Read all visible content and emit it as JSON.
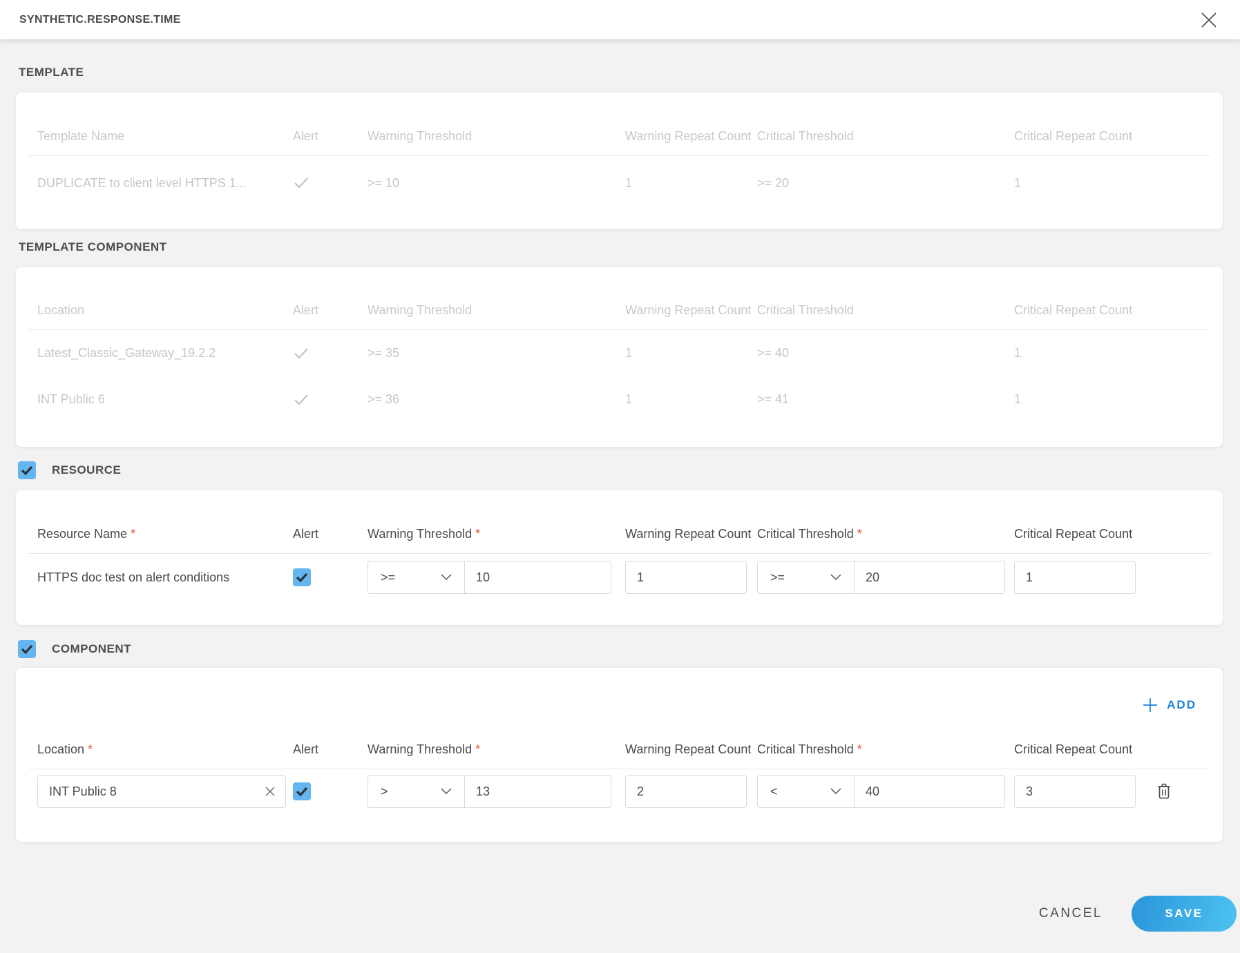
{
  "modal": {
    "title": "SYNTHETIC.RESPONSE.TIME"
  },
  "required_marker": "*",
  "colors": {
    "accent_blue": "#1b82dd",
    "checkbox_blue": "#64b5f0",
    "required_red": "#e4502e",
    "save_gradient_start": "#2b95d9",
    "save_gradient_end": "#4cc2f1",
    "muted_text": "#c9c9c9"
  },
  "icons": {
    "close": "close-icon",
    "check": "check-icon",
    "chevron_down": "chevron-down-icon",
    "plus": "plus-icon",
    "trash": "trash-icon",
    "clear": "clear-icon"
  },
  "sections": {
    "template": {
      "title": "TEMPLATE",
      "headers": {
        "name": "Template Name",
        "alert": "Alert",
        "warning_threshold": "Warning Threshold",
        "warning_repeat": "Warning Repeat Count",
        "critical_threshold": "Critical Threshold",
        "critical_repeat": "Critical Repeat Count"
      },
      "rows": [
        {
          "name": "DUPLICATE to client level HTTPS 1...",
          "alert_checked": true,
          "warning_threshold": ">= 10",
          "warning_repeat": "1",
          "critical_threshold": ">= 20",
          "critical_repeat": "1"
        }
      ]
    },
    "template_component": {
      "title": "TEMPLATE COMPONENT",
      "headers": {
        "name": "Location",
        "alert": "Alert",
        "warning_threshold": "Warning Threshold",
        "warning_repeat": "Warning Repeat Count",
        "critical_threshold": "Critical Threshold",
        "critical_repeat": "Critical Repeat Count"
      },
      "rows": [
        {
          "name": "Latest_Classic_Gateway_19.2.2",
          "alert_checked": true,
          "warning_threshold": ">= 35",
          "warning_repeat": "1",
          "critical_threshold": ">= 40",
          "critical_repeat": "1"
        },
        {
          "name": "INT Public 6",
          "alert_checked": true,
          "warning_threshold": ">= 36",
          "warning_repeat": "1",
          "critical_threshold": ">= 41",
          "critical_repeat": "1"
        }
      ]
    },
    "resource": {
      "title": "RESOURCE",
      "enabled": true,
      "headers": {
        "name": "Resource Name",
        "alert": "Alert",
        "warning_threshold": "Warning Threshold",
        "warning_repeat": "Warning Repeat Count",
        "critical_threshold": "Critical Threshold",
        "critical_repeat": "Critical Repeat Count"
      },
      "row": {
        "name": "HTTPS doc test on alert conditions",
        "alert_checked": true,
        "warning_operator": ">=",
        "warning_value": "10",
        "warning_repeat": "1",
        "critical_operator": ">=",
        "critical_value": "20",
        "critical_repeat": "1"
      }
    },
    "component": {
      "title": "COMPONENT",
      "enabled": true,
      "add_label": "ADD",
      "headers": {
        "name": "Location",
        "alert": "Alert",
        "warning_threshold": "Warning Threshold",
        "warning_repeat": "Warning Repeat Count",
        "critical_threshold": "Critical Threshold",
        "critical_repeat": "Critical Repeat Count"
      },
      "row": {
        "location": "INT Public 8",
        "alert_checked": true,
        "warning_operator": ">",
        "warning_value": "13",
        "warning_repeat": "2",
        "critical_operator": "<",
        "critical_value": "40",
        "critical_repeat": "3"
      }
    }
  },
  "footer": {
    "cancel_label": "CANCEL",
    "save_label": "SAVE"
  }
}
